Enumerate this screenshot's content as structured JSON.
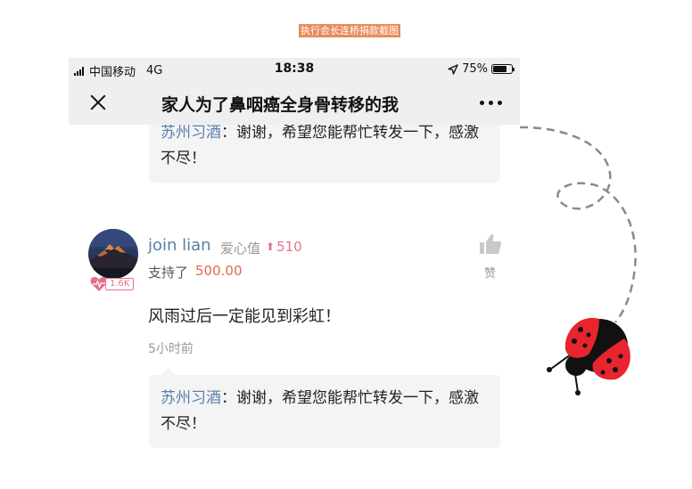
{
  "caption": "执行会长连桥捐款截图",
  "status_bar": {
    "carrier": "中国移动",
    "network": "4G",
    "time": "18:38",
    "battery": "75%",
    "battery_level": 0.75
  },
  "nav": {
    "title": "家人为了鼻咽癌全身骨转移的我"
  },
  "reply_top": {
    "name": "苏州习酒",
    "text": "：谢谢，希望您能帮忙转发一下，感激不尽！"
  },
  "comment": {
    "username": "join lian",
    "love_label": "爱心值",
    "love_value": "510",
    "support_label": "支持了",
    "support_amount": "500.00",
    "heart_count": "1.6K",
    "like_label": "赞",
    "text": "风雨过后一定能见到彩虹！",
    "time": "5小时前"
  },
  "reply_bottom": {
    "name": "苏州习酒",
    "text": "：谢谢，希望您能帮忙转发一下，感激不尽！"
  },
  "colors": {
    "link_blue": "#5b7fa8",
    "pink": "#e6708a",
    "amount_red": "#e06a4e",
    "ladybug_red": "#e8242f"
  }
}
